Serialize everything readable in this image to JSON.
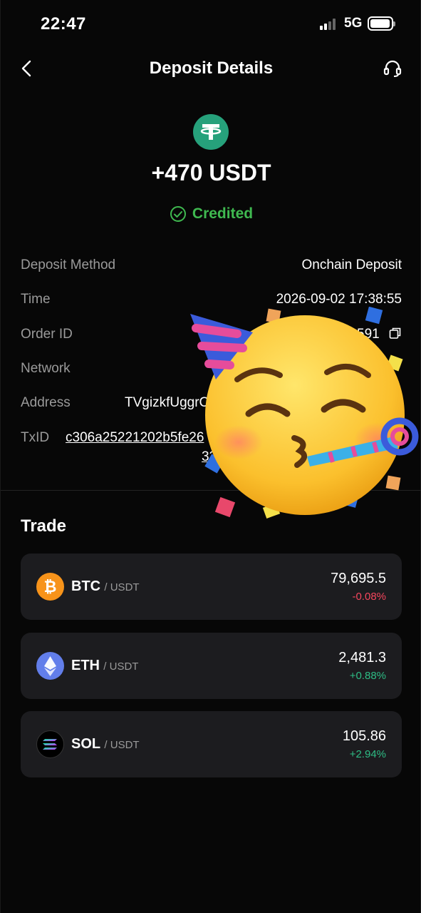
{
  "status_bar": {
    "time": "22:47",
    "network": "5G"
  },
  "header": {
    "title": "Deposit Details"
  },
  "hero": {
    "amount": "+470 USDT",
    "status": "Credited"
  },
  "details": {
    "method_label": "Deposit Method",
    "method_value": "Onchain Deposit",
    "time_label": "Time",
    "time_value": "2026-09-02 17:38:55",
    "order_label": "Order ID",
    "order_value": "591",
    "network_label": "Network",
    "address_label": "Address",
    "address_value": "TVgizkfUggrC",
    "txid_label": "TxID",
    "txid_line1": "c306a25221202b5fe26",
    "txid_line2": "33"
  },
  "trade": {
    "title": "Trade",
    "pairs": [
      {
        "base": "BTC",
        "quote": "/ USDT",
        "price": "79,695.5",
        "change": "-0.08%",
        "direction": "down",
        "color": "#f7931a"
      },
      {
        "base": "ETH",
        "quote": "/ USDT",
        "price": "2,481.3",
        "change": "+0.88%",
        "direction": "up",
        "color": "#627eea"
      },
      {
        "base": "SOL",
        "quote": "/ USDT",
        "price": "105.86",
        "change": "+2.94%",
        "direction": "up",
        "color": "#000000"
      }
    ]
  },
  "colors": {
    "credited": "#3fb950",
    "usdt": "#26a17b",
    "down": "#f6465d",
    "up": "#2ebd85"
  },
  "icons": [
    "back-arrow-icon",
    "headset-icon",
    "tether-icon",
    "check-circle-icon",
    "copy-icon",
    "bitcoin-icon",
    "ethereum-icon",
    "solana-icon",
    "party-face-emoji"
  ]
}
